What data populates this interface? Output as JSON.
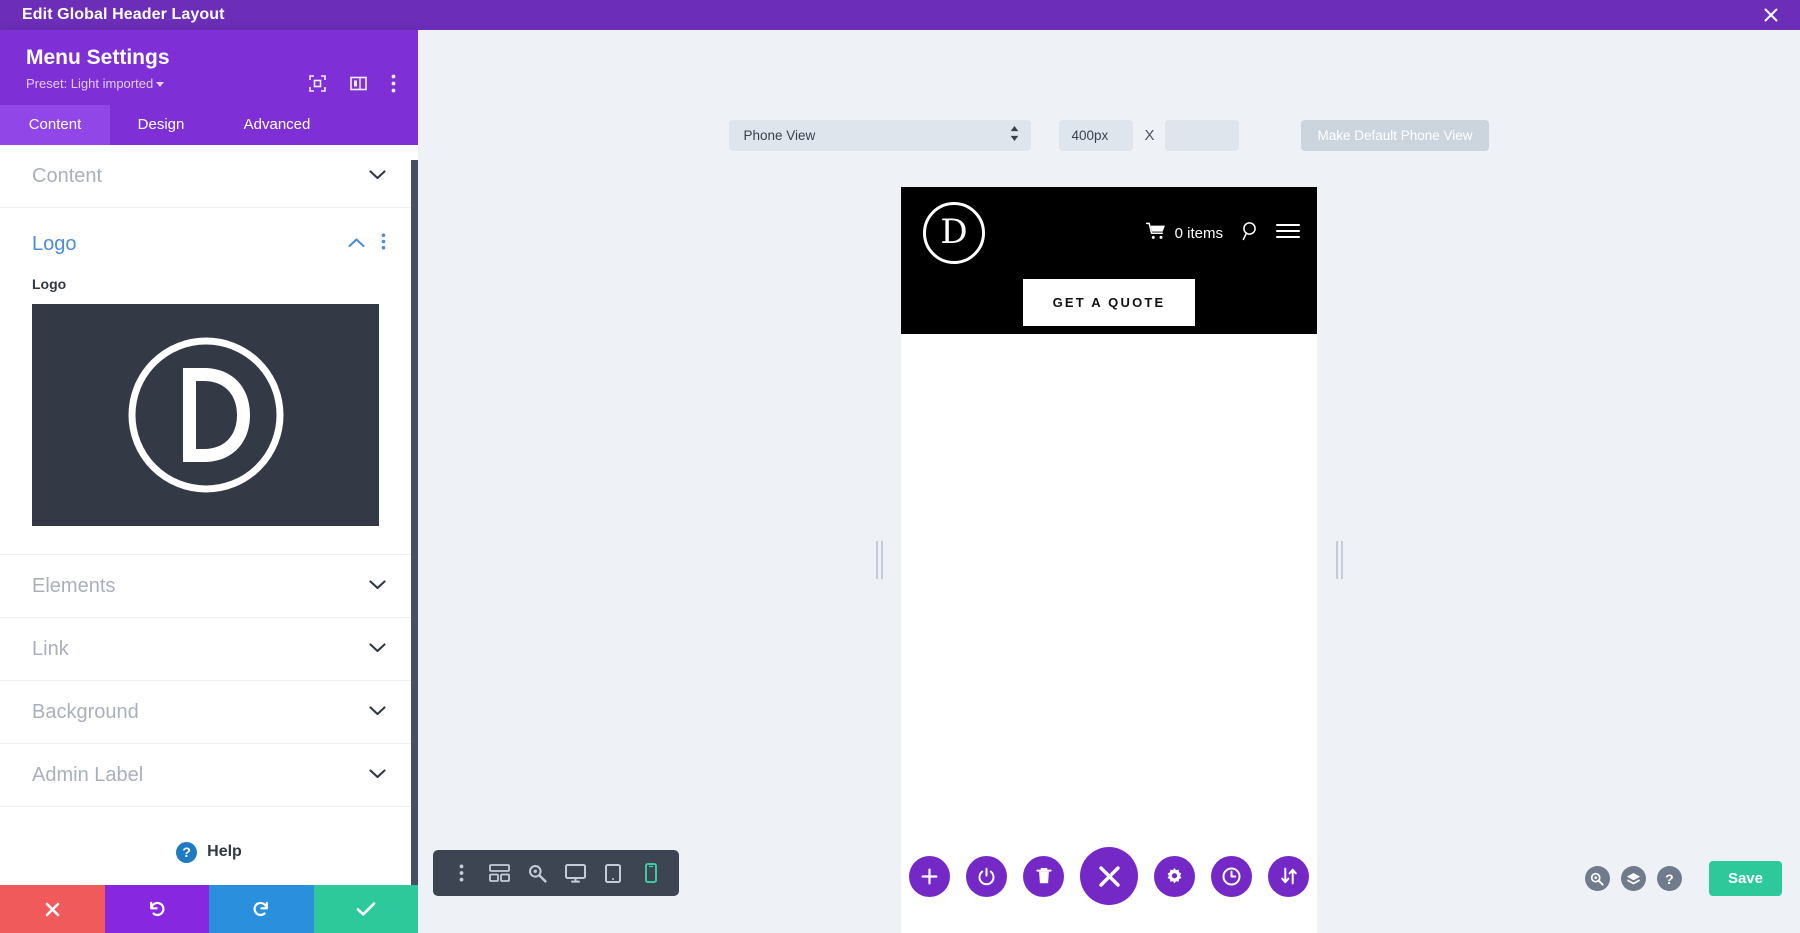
{
  "titlebar": {
    "title": "Edit Global Header Layout",
    "close_icon": "close-icon"
  },
  "panel": {
    "heading": "Menu Settings",
    "preset_label": "Preset: Light imported",
    "head_icons": [
      "focus-frame-icon",
      "panel-layout-icon",
      "vertical-dots-icon"
    ],
    "tabs": [
      {
        "label": "Content",
        "active": true
      },
      {
        "label": "Design",
        "active": false
      },
      {
        "label": "Advanced",
        "active": false
      }
    ],
    "sections": [
      {
        "label": "Content",
        "state": "collapsed"
      },
      {
        "label": "Logo",
        "state": "expanded"
      },
      {
        "label": "Elements",
        "state": "collapsed"
      },
      {
        "label": "Link",
        "state": "collapsed"
      },
      {
        "label": "Background",
        "state": "collapsed"
      },
      {
        "label": "Admin Label",
        "state": "collapsed"
      }
    ],
    "logo_field": {
      "label": "Logo",
      "thumb_letter": "D",
      "thumb_bg": "#333a45"
    },
    "help": {
      "label": "Help",
      "icon": "question-mark-icon"
    },
    "actions": [
      {
        "name": "discard",
        "icon": "close-icon",
        "color": "#f05a5a"
      },
      {
        "name": "undo",
        "icon": "undo-arrow-icon",
        "color": "#8728e0"
      },
      {
        "name": "redo",
        "icon": "redo-arrow-icon",
        "color": "#2a8fdd"
      },
      {
        "name": "save",
        "icon": "check-icon",
        "color": "#2dc99b"
      }
    ]
  },
  "viewport": {
    "view_mode": "Phone View",
    "width_value": "400px",
    "height_value": "",
    "height_placeholder": "",
    "multiply_symbol": "X",
    "make_default_label": "Make Default Phone View"
  },
  "preview": {
    "header": {
      "logo_letter": "D",
      "cart_icon": "shopping-cart-icon",
      "cart_label": "0 items",
      "search_icon": "search-icon",
      "menu_icon": "hamburger-menu-icon",
      "cta_label": "GET A QUOTE",
      "background": "#000000"
    },
    "body_background": "#ffffff"
  },
  "mode_toolbar": {
    "items": [
      {
        "name": "vertical-dots-icon",
        "active": false
      },
      {
        "name": "wireframe-grid-icon",
        "active": false
      },
      {
        "name": "zoom-magnifier-icon",
        "active": false
      },
      {
        "name": "desktop-view-icon",
        "active": false
      },
      {
        "name": "tablet-view-icon",
        "active": false
      },
      {
        "name": "phone-view-icon",
        "active": true
      }
    ],
    "active_color": "#3fc9a0"
  },
  "round_toolbar": {
    "color": "#7429c6",
    "items": [
      {
        "name": "add-icon",
        "size": "small"
      },
      {
        "name": "power-icon",
        "size": "small"
      },
      {
        "name": "trash-icon",
        "size": "small"
      },
      {
        "name": "close-icon",
        "size": "large"
      },
      {
        "name": "gear-icon",
        "size": "small"
      },
      {
        "name": "history-clock-icon",
        "size": "small"
      },
      {
        "name": "sort-arrows-icon",
        "size": "small"
      }
    ]
  },
  "right_tools": {
    "icons": [
      "zoom-magnifier-icon",
      "layers-icon",
      "help-question-icon"
    ],
    "save_label": "Save",
    "save_color": "#2dc99b"
  }
}
